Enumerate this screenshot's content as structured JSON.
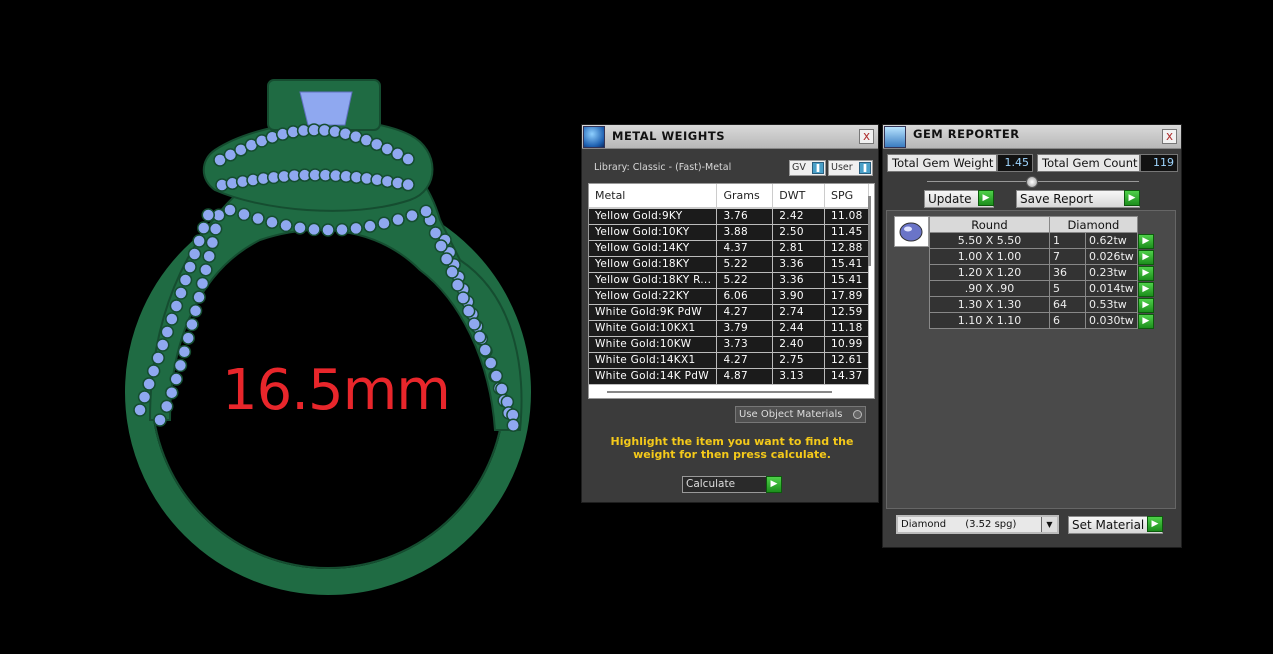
{
  "viewport": {
    "ring_size_label": "16.5mm",
    "colors": {
      "metal": "#1f6b43",
      "metal_edge": "#154d30",
      "gem": "#8fa8f0",
      "label": "#e8262b"
    }
  },
  "metal_weights": {
    "title": "METAL WEIGHTS",
    "close": "x",
    "library_label": "Library: Classic - (Fast)-Metal",
    "gv_label": "GV",
    "user_label": "User",
    "columns": [
      "Metal",
      "Grams",
      "DWT",
      "SPG"
    ],
    "rows": [
      [
        "Yellow Gold:9KY",
        "3.76",
        "2.42",
        "11.08"
      ],
      [
        "Yellow Gold:10KY",
        "3.88",
        "2.50",
        "11.45"
      ],
      [
        "Yellow Gold:14KY",
        "4.37",
        "2.81",
        "12.88"
      ],
      [
        "Yellow Gold:18KY",
        "5.22",
        "3.36",
        "15.41"
      ],
      [
        "Yellow Gold:18KY R...",
        "5.22",
        "3.36",
        "15.41"
      ],
      [
        "Yellow Gold:22KY",
        "6.06",
        "3.90",
        "17.89"
      ],
      [
        "White Gold:9K PdW",
        "4.27",
        "2.74",
        "12.59"
      ],
      [
        "White Gold:10KX1",
        "3.79",
        "2.44",
        "11.18"
      ],
      [
        "White Gold:10KW",
        "3.73",
        "2.40",
        "10.99"
      ],
      [
        "White Gold:14KX1",
        "4.27",
        "2.75",
        "12.61"
      ],
      [
        "White Gold:14K PdW",
        "4.87",
        "3.13",
        "14.37"
      ]
    ],
    "use_object_materials": "Use Object Materials",
    "instruction": "Highlight the item you want to find the weight for then press calculate.",
    "calculate_label": "Calculate"
  },
  "gem_reporter": {
    "title": "GEM REPORTER",
    "close": "x",
    "total_weight_label": "Total Gem Weight",
    "total_weight_value": "1.45",
    "total_count_label": "Total Gem Count",
    "total_count_value": "119",
    "update_label": "Update",
    "save_report_label": "Save Report",
    "table_headers": [
      "Round",
      "Diamond"
    ],
    "gems": [
      {
        "size": "5.50 X 5.50",
        "count": "1",
        "weight": "0.62tw"
      },
      {
        "size": "1.00 X 1.00",
        "count": "7",
        "weight": "0.026tw"
      },
      {
        "size": "1.20 X 1.20",
        "count": "36",
        "weight": "0.23tw"
      },
      {
        "size": ".90 X .90",
        "count": "5",
        "weight": "0.014tw"
      },
      {
        "size": "1.30 X 1.30",
        "count": "64",
        "weight": "0.53tw"
      },
      {
        "size": "1.10 X 1.10",
        "count": "6",
        "weight": "0.030tw"
      }
    ],
    "material_selected": "Diamond      (3.52 spg)",
    "set_material_label": "Set Material"
  }
}
